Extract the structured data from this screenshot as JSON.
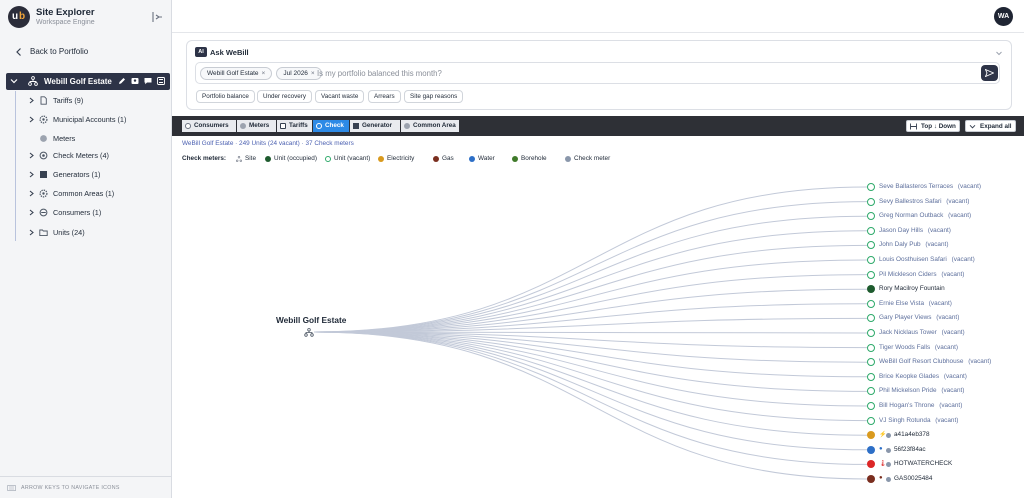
{
  "app": {
    "title": "Site Explorer",
    "subtitle": "Workspace Engine",
    "logo_u": "u",
    "logo_b": "b"
  },
  "sidebar": {
    "back_label": "Back to Portfolio",
    "root_label": "Webill Golf Estate",
    "items": [
      {
        "label": "Tariffs (9)",
        "icon": "document-icon",
        "has_caret": true
      },
      {
        "label": "Municipal Accounts (1)",
        "icon": "gear-icon",
        "has_caret": true
      },
      {
        "label": "Meters",
        "icon": "meter-dot-icon",
        "has_caret": false
      },
      {
        "label": "Check Meters (4)",
        "icon": "target-icon",
        "has_caret": true
      },
      {
        "label": "Generators (1)",
        "icon": "generator-icon",
        "has_caret": true
      },
      {
        "label": "Common Areas (1)",
        "icon": "gear-icon",
        "has_caret": true
      },
      {
        "label": "Consumers (1)",
        "icon": "consumer-icon",
        "has_caret": true
      },
      {
        "label": "Units (24)",
        "icon": "folder-icon",
        "has_caret": true
      }
    ],
    "footer_hint": "ARROW KEYS TO NAVIGATE ICONS"
  },
  "header": {
    "avatar_initials": "WA"
  },
  "ask": {
    "badge": "AI",
    "title": "Ask WeBill",
    "chips": [
      {
        "label": "Webill Golf Estate"
      },
      {
        "label": "Jul 2026"
      }
    ],
    "placeholder": "Is my portfolio balanced this month?",
    "suggestions": [
      "Portfolio balance",
      "Under recovery",
      "Vacant waste",
      "Arrears",
      "Site gap reasons"
    ]
  },
  "toolbar": {
    "tabs": [
      {
        "label": "Consumers",
        "active": false
      },
      {
        "label": "Meters",
        "active": false
      },
      {
        "label": "Tariffs",
        "active": false
      },
      {
        "label": "Check",
        "active": true
      },
      {
        "label": "Generator",
        "active": false
      },
      {
        "label": "Common Area",
        "active": false
      }
    ],
    "top_down_label": "Top ↓ Down",
    "expand_label": "Expand all"
  },
  "summary": "WeBill Golf Estate · 249 Units (24 vacant) · 37 Check meters",
  "legend": {
    "title": "Check meters:",
    "items": [
      {
        "label": "Site",
        "color": "#6b7280",
        "kind": "site"
      },
      {
        "label": "Unit (occupied)",
        "color": "#1e5b2e",
        "kind": "dot"
      },
      {
        "label": "Unit (vacant)",
        "color": "#2eaa6a",
        "kind": "ring"
      },
      {
        "label": "Electricity",
        "color": "#d99a1e",
        "kind": "dot"
      },
      {
        "label": "Gas",
        "color": "#7a2e1f",
        "kind": "dot"
      },
      {
        "label": "Water",
        "color": "#2d6fc7",
        "kind": "dot"
      },
      {
        "label": "Borehole",
        "color": "#3f7a2a",
        "kind": "dot"
      },
      {
        "label": "Check meter",
        "color": "#8a97ab",
        "kind": "dot"
      }
    ]
  },
  "tree": {
    "root_label": "Webill Golf Estate",
    "leaves": [
      {
        "name": "Seve Ballasteros Terraces",
        "status": "(vacant)",
        "type": "vacant"
      },
      {
        "name": "Sevy Ballestros Safari",
        "status": "(vacant)",
        "type": "vacant"
      },
      {
        "name": "Greg Norman Outback",
        "status": "(vacant)",
        "type": "vacant"
      },
      {
        "name": "Jason Day Hills",
        "status": "(vacant)",
        "type": "vacant"
      },
      {
        "name": "John Daly Pub",
        "status": "(vacant)",
        "type": "vacant"
      },
      {
        "name": "Louis Oosthuisen Safari",
        "status": "(vacant)",
        "type": "vacant"
      },
      {
        "name": "Pil Mickleson Ciders",
        "status": "(vacant)",
        "type": "vacant"
      },
      {
        "name": "Rory Macilroy Fountain",
        "status": "",
        "type": "occupied"
      },
      {
        "name": "Ernie Else Vista",
        "status": "(vacant)",
        "type": "vacant"
      },
      {
        "name": "Gary Player Views",
        "status": "(vacant)",
        "type": "vacant"
      },
      {
        "name": "Jack Nicklaus Tower",
        "status": "(vacant)",
        "type": "vacant"
      },
      {
        "name": "Tiger Woods Falls",
        "status": "(vacant)",
        "type": "vacant"
      },
      {
        "name": "WeBill Golf Resort Clubhouse",
        "status": "(vacant)",
        "type": "vacant"
      },
      {
        "name": "Brice Keopke Glades",
        "status": "(vacant)",
        "type": "vacant"
      },
      {
        "name": "Phil Mickelson Pride",
        "status": "(vacant)",
        "type": "vacant"
      },
      {
        "name": "Bill Hogan's Throne",
        "status": "(vacant)",
        "type": "vacant"
      },
      {
        "name": "VJ Singh Rotunda",
        "status": "(vacant)",
        "type": "vacant"
      },
      {
        "name": "a41a4eb378",
        "status": "",
        "type": "electricity",
        "color": "#d99a1e",
        "glyph": "⚡"
      },
      {
        "name": "56f23f84ac",
        "status": "",
        "type": "water",
        "color": "#2d6fc7",
        "glyph": "●"
      },
      {
        "name": "HOTWATERCHECK",
        "status": "",
        "type": "hotwater",
        "color": "#dc2626",
        "glyph": "🌡"
      },
      {
        "name": "GAS0025484",
        "status": "",
        "type": "gas",
        "color": "#7a2e1f",
        "glyph": "●"
      }
    ]
  }
}
